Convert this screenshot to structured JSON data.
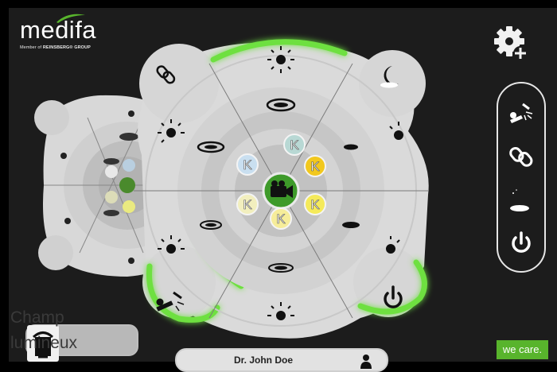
{
  "brand": {
    "name": "medifa",
    "tagline_prefix": "Member of",
    "tagline_group": "REINSBERG® GROUP",
    "slogan": "we care.",
    "accent_color": "#58b42c",
    "glow_color": "#6ee040"
  },
  "toolbar": {
    "settings_icon": "gear-plus-icon",
    "side_buttons": [
      {
        "name": "patient-position-button",
        "icon": "patient-light-icon"
      },
      {
        "name": "link-button",
        "icon": "link-icon"
      },
      {
        "name": "night-mode-button",
        "icon": "moon-cloud-icon"
      },
      {
        "name": "power-button",
        "icon": "power-icon"
      }
    ]
  },
  "light_control": {
    "center_icon": "camera-icon",
    "center_label": "K",
    "color_temperature_labels": [
      "K",
      "K",
      "K",
      "K",
      "K",
      "K"
    ],
    "color_temperature_colors": [
      "#b8d8d4",
      "#f2c81e",
      "#f5ea5a",
      "#f6ed9a",
      "#f2efbe",
      "#c9dff0"
    ]
  },
  "bottom": {
    "field_label": "Champ lumineux",
    "user_name": "Dr. John Doe"
  }
}
